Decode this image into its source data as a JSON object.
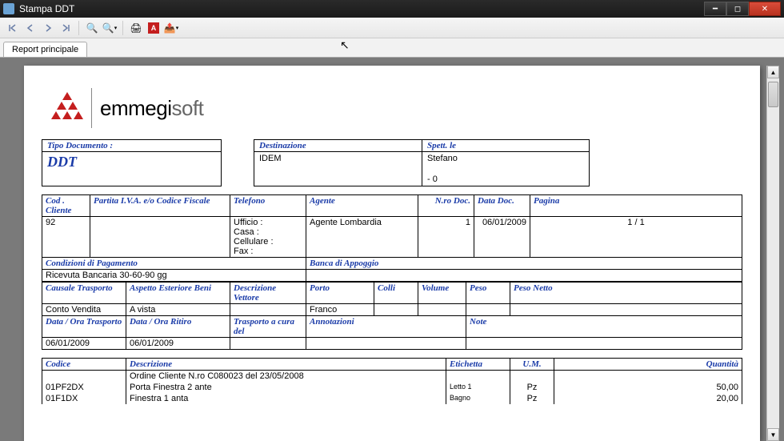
{
  "window": {
    "title": "Stampa DDT"
  },
  "tabs": {
    "main": "Report principale"
  },
  "logo": {
    "brand_bold": "emmegi",
    "brand_thin": "soft"
  },
  "header_blocks": {
    "tipo_doc_label": "Tipo Documento :",
    "tipo_doc_value": "DDT",
    "destinazione_label": "Destinazione",
    "destinazione_value": "IDEM",
    "spett_label": "Spett. le",
    "spett_value": "Stefano",
    "spett_sub": "- 0"
  },
  "info_row1": {
    "cod_cliente_label": "Cod . Cliente",
    "cod_cliente": "92",
    "partita_label": "Partita I.V.A. e/o Codice Fiscale",
    "partita": "",
    "telefono_label": "Telefono",
    "telefono_lines": [
      "Ufficio :",
      "Casa :",
      "Cellulare :",
      "Fax :"
    ],
    "agente_label": "Agente",
    "agente": "Agente Lombardia",
    "nro_doc_label": "N.ro Doc.",
    "nro_doc": "1",
    "data_doc_label": "Data Doc.",
    "data_doc": "06/01/2009",
    "pagina_label": "Pagina",
    "pagina": "1 / 1"
  },
  "info_row2": {
    "condizioni_label": "Condizioni di Pagamento",
    "condizioni": "Ricevuta Bancaria 30-60-90 gg",
    "banca_label": "Banca di Appoggio",
    "banca": ""
  },
  "info_row3": {
    "causale_label": "Causale Trasporto",
    "causale": "Conto Vendita",
    "aspetto_label": "Aspetto Esteriore Beni",
    "aspetto": "A vista",
    "desc_vettore_label": "Descrizione Vettore",
    "desc_vettore": "",
    "porto_label": "Porto",
    "porto": "Franco",
    "colli_label": "Colli",
    "volume_label": "Volume",
    "peso_label": "Peso",
    "peso_netto_label": "Peso Netto"
  },
  "info_row4": {
    "data_trasporto_label": "Data / Ora Trasporto",
    "data_trasporto": "06/01/2009",
    "data_ritiro_label": "Data / Ora Ritiro",
    "data_ritiro": "06/01/2009",
    "trasporto_cura_label": "Trasporto a cura del",
    "annotazioni_label": "Annotazioni",
    "note_label": "Note"
  },
  "items": {
    "headers": {
      "codice": "Codice",
      "descrizione": "Descrizione",
      "etichetta": "Etichetta",
      "um": "U.M.",
      "quantita": "Quantità"
    },
    "order_line": "Ordine Cliente N.ro C080023 del 23/05/2008",
    "rows": [
      {
        "codice": "01PF2DX",
        "descrizione": "Porta Finestra 2 ante",
        "etichetta": "Letto 1",
        "um": "Pz",
        "quantita": "50,00"
      },
      {
        "codice": "01F1DX",
        "descrizione": "Finestra 1 anta",
        "etichetta": "Bagno",
        "um": "Pz",
        "quantita": "20,00"
      }
    ]
  }
}
